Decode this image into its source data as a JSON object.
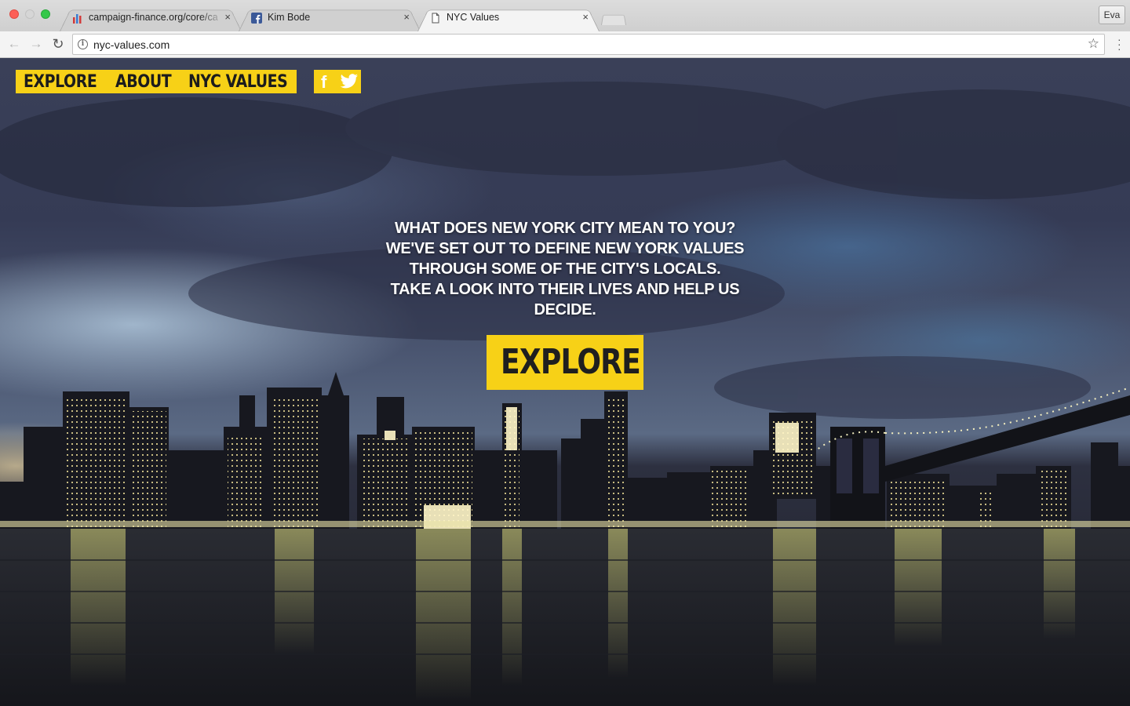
{
  "browser": {
    "tabs": [
      {
        "title": "campaign-finance.org/core/ca",
        "icon": "bar-chart-favicon",
        "active": false
      },
      {
        "title": "Kim Bode",
        "icon": "facebook-favicon",
        "active": false
      },
      {
        "title": "NYC Values",
        "icon": "page-favicon",
        "active": true
      }
    ],
    "close_glyph": "×",
    "profile_name": "Eva",
    "url": "nyc-values.com"
  },
  "site": {
    "nav": {
      "explore": "EXPLORE",
      "about": "ABOUT",
      "nyc_values": "NYC VALUES"
    },
    "social": {
      "facebook": "f",
      "twitter_icon": "twitter-bird-icon"
    },
    "hero": {
      "lines": [
        "WHAT DOES NEW YORK CITY MEAN TO YOU?",
        "WE'VE SET OUT TO DEFINE NEW YORK VALUES",
        "THROUGH SOME OF THE CITY'S LOCALS.",
        "TAKE A LOOK INTO THEIR LIVES AND HELP US",
        "DECIDE."
      ],
      "cta": "EXPLORE"
    },
    "colors": {
      "accent": "#f7d117",
      "nav_text": "#1c1c1c"
    }
  }
}
